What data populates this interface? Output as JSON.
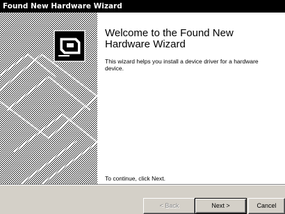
{
  "window": {
    "title": "Found New Hardware Wizard"
  },
  "main": {
    "heading": "Welcome to the Found New Hardware Wizard",
    "description": "This wizard helps you install a device driver for a hardware device.",
    "footer": "To continue, click Next."
  },
  "buttons": {
    "back": "< Back",
    "next": "Next >",
    "cancel": "Cancel"
  },
  "icons": {
    "wizard_graphic": "hardware-card-icon"
  }
}
